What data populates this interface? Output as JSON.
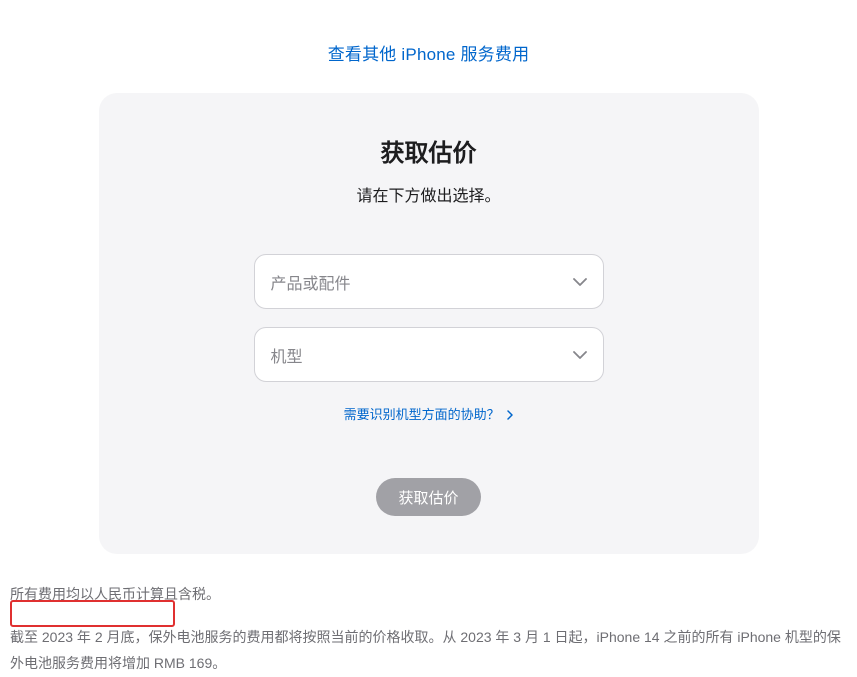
{
  "topLink": {
    "label": "查看其他 iPhone 服务费用"
  },
  "card": {
    "title": "获取估价",
    "subtitle": "请在下方做出选择。",
    "select1": {
      "placeholder": "产品或配件"
    },
    "select2": {
      "placeholder": "机型"
    },
    "helpLink": {
      "label": "需要识别机型方面的协助？"
    },
    "submitLabel": "获取估价"
  },
  "footer": {
    "line1": "所有费用均以人民币计算且含税。",
    "line2": "截至 2023 年 2 月底，保外电池服务的费用都将按照当前的价格收取。从 2023 年 3 月 1 日起，iPhone 14 之前的所有 iPhone 机型的保外电池服务费用将增加 RMB 169。"
  }
}
